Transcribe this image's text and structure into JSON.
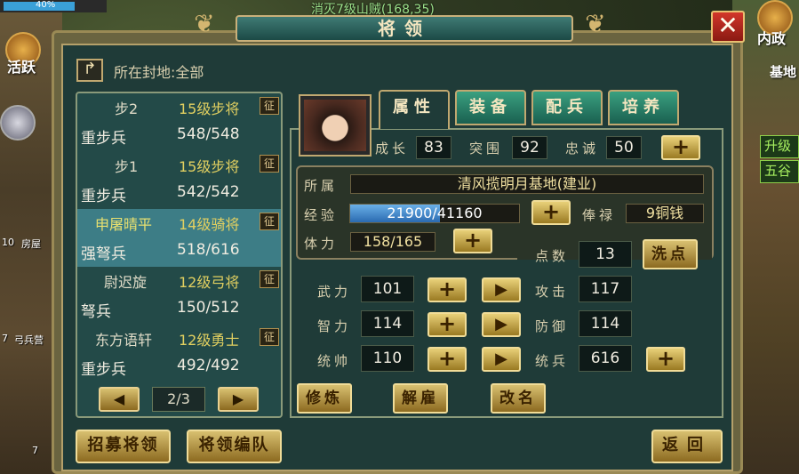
{
  "hud": {
    "hp_percent": "40%",
    "quest": "消灭7级山贼(168,35)",
    "left_label": "活跃",
    "left_house": "房屋",
    "left_house_level": "10",
    "left_barracks": "弓兵营",
    "left_barracks_level": "7",
    "left_small_level": "7",
    "right_label": "内政",
    "right_base": "基地",
    "right_box1": "升级",
    "right_box2": "五谷"
  },
  "window": {
    "title": "将领",
    "close_label": "✕"
  },
  "fief": {
    "back_icon": "↱",
    "label": "所在封地:全部"
  },
  "generals": [
    {
      "name": "步2",
      "rank": "15级步将",
      "zheng": "征",
      "troop": "重步兵",
      "count": "548/548",
      "selected": false
    },
    {
      "name": "步1",
      "rank": "15级步将",
      "zheng": "征",
      "troop": "重步兵",
      "count": "542/542",
      "selected": false
    },
    {
      "name": "申屠晴平",
      "rank": "14级骑将",
      "zheng": "征",
      "troop": "强弩兵",
      "count": "518/616",
      "selected": true
    },
    {
      "name": "尉迟旋",
      "rank": "12级弓将",
      "zheng": "征",
      "troop": "弩兵",
      "count": "150/512",
      "selected": false
    },
    {
      "name": "东方语轩",
      "rank": "12级勇士",
      "zheng": "征",
      "troop": "重步兵",
      "count": "492/492",
      "selected": false
    }
  ],
  "pager": {
    "prev": "◀",
    "next": "▶",
    "text": "2/3"
  },
  "tabs": [
    "属性",
    "装备",
    "配兵",
    "培养"
  ],
  "stats": {
    "growth_label": "成长",
    "growth": "83",
    "breakthrough_label": "突围",
    "breakthrough": "92",
    "loyalty_label": "忠诚",
    "loyalty": "50",
    "faction_label": "所属",
    "faction": "清风揽明月基地(建业)",
    "exp_label": "经验",
    "exp": "21900/41160",
    "exp_fraction": 0.532,
    "salary_label": "俸禄",
    "salary": "9铜钱",
    "stamina_label": "体力",
    "stamina": "158/165",
    "points_label": "点数",
    "points": "13",
    "reset_label": "洗点",
    "force_label": "武力",
    "force": "101",
    "intellect_label": "智力",
    "intellect": "114",
    "command_label": "统帅",
    "command": "110",
    "attack_label": "攻击",
    "attack": "117",
    "defense_label": "防御",
    "defense": "114",
    "troops_label": "统兵",
    "troops": "616"
  },
  "buttons": {
    "plus": "+",
    "arrow": "▶",
    "train": "修炼",
    "dismiss": "解雇",
    "rename": "改名",
    "recruit": "招募将领",
    "formation": "将领编队",
    "back": "返回"
  }
}
